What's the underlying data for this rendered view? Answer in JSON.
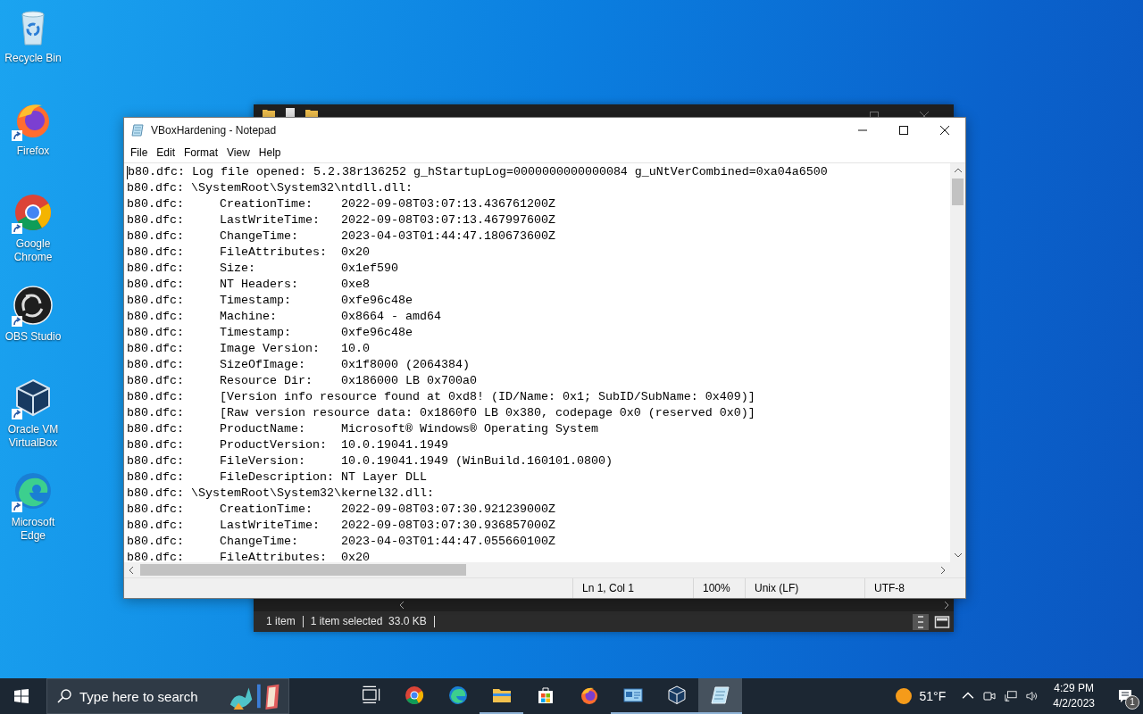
{
  "desktop_icons": [
    {
      "kind": "recycle",
      "label": "Recycle Bin",
      "shortcut": false
    },
    {
      "kind": "firefox",
      "label": "Firefox",
      "shortcut": true
    },
    {
      "kind": "chrome",
      "label": "Google Chrome",
      "shortcut": true
    },
    {
      "kind": "obs",
      "label": "OBS Studio",
      "shortcut": true
    },
    {
      "kind": "virtualbox",
      "label": "Oracle VM VirtualBox",
      "shortcut": true
    },
    {
      "kind": "edge",
      "label": "Microsoft Edge",
      "shortcut": true
    }
  ],
  "background_window": {
    "status_items": [
      "1 item",
      "1 item selected  33.0 KB"
    ]
  },
  "notepad": {
    "title": "VBoxHardening - Notepad",
    "menu": [
      "File",
      "Edit",
      "Format",
      "View",
      "Help"
    ],
    "lines": [
      "b80.dfc: Log file opened: 5.2.38r136252 g_hStartupLog=0000000000000084 g_uNtVerCombined=0xa04a6500",
      "b80.dfc: \\SystemRoot\\System32\\ntdll.dll:",
      "b80.dfc:     CreationTime:    2022-09-08T03:07:13.436761200Z",
      "b80.dfc:     LastWriteTime:   2022-09-08T03:07:13.467997600Z",
      "b80.dfc:     ChangeTime:      2023-04-03T01:44:47.180673600Z",
      "b80.dfc:     FileAttributes:  0x20",
      "b80.dfc:     Size:            0x1ef590",
      "b80.dfc:     NT Headers:      0xe8",
      "b80.dfc:     Timestamp:       0xfe96c48e",
      "b80.dfc:     Machine:         0x8664 - amd64",
      "b80.dfc:     Timestamp:       0xfe96c48e",
      "b80.dfc:     Image Version:   10.0",
      "b80.dfc:     SizeOfImage:     0x1f8000 (2064384)",
      "b80.dfc:     Resource Dir:    0x186000 LB 0x700a0",
      "b80.dfc:     [Version info resource found at 0xd8! (ID/Name: 0x1; SubID/SubName: 0x409)]",
      "b80.dfc:     [Raw version resource data: 0x1860f0 LB 0x380, codepage 0x0 (reserved 0x0)]",
      "b80.dfc:     ProductName:     Microsoft® Windows® Operating System",
      "b80.dfc:     ProductVersion:  10.0.19041.1949",
      "b80.dfc:     FileVersion:     10.0.19041.1949 (WinBuild.160101.0800)",
      "b80.dfc:     FileDescription: NT Layer DLL",
      "b80.dfc: \\SystemRoot\\System32\\kernel32.dll:",
      "b80.dfc:     CreationTime:    2022-09-08T03:07:30.921239000Z",
      "b80.dfc:     LastWriteTime:   2022-09-08T03:07:30.936857000Z",
      "b80.dfc:     ChangeTime:      2023-04-03T01:44:47.055660100Z",
      "b80.dfc:     FileAttributes:  0x20"
    ],
    "status": {
      "position": "Ln 1, Col 1",
      "zoom": "100%",
      "line_ending": "Unix (LF)",
      "encoding": "UTF-8"
    }
  },
  "taskbar": {
    "search_placeholder": "Type here to search",
    "apps": [
      {
        "kind": "chrome",
        "running": false,
        "selected": false
      },
      {
        "kind": "edge",
        "running": false,
        "selected": false
      },
      {
        "kind": "explorer",
        "running": true,
        "selected": false
      },
      {
        "kind": "store",
        "running": false,
        "selected": false
      },
      {
        "kind": "firefox",
        "running": false,
        "selected": false
      },
      {
        "kind": "controlpanel",
        "running": true,
        "selected": false
      },
      {
        "kind": "virtualbox",
        "running": true,
        "selected": false
      },
      {
        "kind": "notepad",
        "running": true,
        "selected": true
      }
    ],
    "weather": "51°F",
    "time": "4:29 PM",
    "date": "4/2/2023",
    "notification_count": "1"
  }
}
